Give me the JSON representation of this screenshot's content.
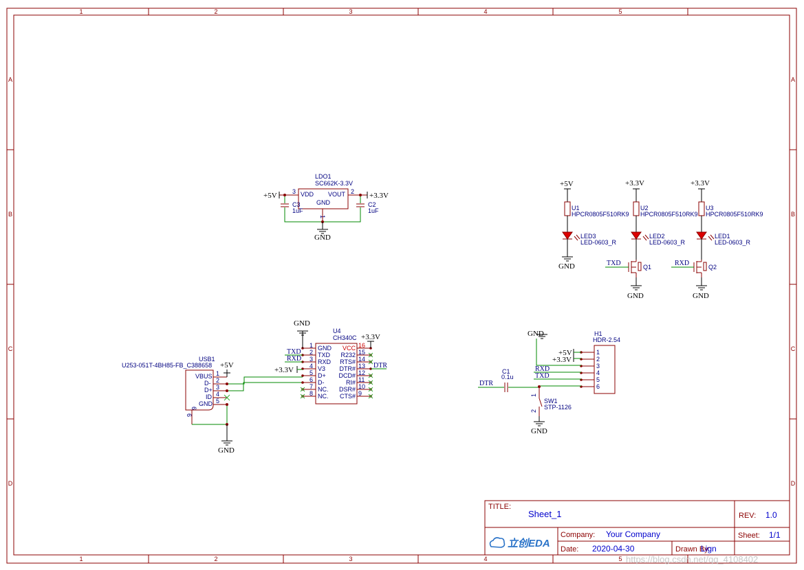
{
  "frame": {
    "columns": [
      "1",
      "2",
      "3",
      "4",
      "5"
    ],
    "rows": [
      "A",
      "B",
      "C",
      "D"
    ]
  },
  "title_block": {
    "title_label": "TITLE:",
    "title": "Sheet_1",
    "rev_label": "REV:",
    "rev": "1.0",
    "company_label": "Company:",
    "company": "Your Company",
    "sheet_label": "Sheet:",
    "sheet": "1/1",
    "date_label": "Date:",
    "date": "2020-04-30",
    "drawn_by_label": "Drawn By:",
    "drawn_by": "Lign",
    "logo": "立创EDA"
  },
  "watermark": "https://blog.csdn.net/qq_4108402",
  "ldo": {
    "ref": "LDO1",
    "part": "SC662K-3.3V",
    "pins": {
      "vdd": "VDD",
      "vout": "VOUT",
      "gnd": "GND",
      "n3": "3",
      "n2": "2",
      "n1": "1"
    },
    "in_net": "+5V",
    "out_net": "+3.3V",
    "gnd_net": "GND",
    "c_left": {
      "ref": "C3",
      "value": "1uF"
    },
    "c_right": {
      "ref": "C2",
      "value": "1uF"
    }
  },
  "leds": [
    {
      "rail": "+5V",
      "res_ref": "U1",
      "res_part": "HPCR0805F510RK9",
      "led_ref": "LED3",
      "led_part": "LED-0603_R",
      "gnd": "GND"
    },
    {
      "rail": "+3.3V",
      "res_ref": "U2",
      "res_part": "HPCR0805F510RK9",
      "led_ref": "LED2",
      "led_part": "LED-0603_R",
      "gnd": "GND",
      "q_ref": "Q1",
      "q_net": "TXD"
    },
    {
      "rail": "+3.3V",
      "res_ref": "U3",
      "res_part": "HPCR0805F510RK9",
      "led_ref": "LED1",
      "led_part": "LED-0603_R",
      "gnd": "GND",
      "q_ref": "Q2",
      "q_net": "RXD"
    }
  ],
  "usb": {
    "ref": "USB1",
    "part": "U253-051T-4BH85-FB_C388658",
    "pins": [
      {
        "num": "1",
        "name": "VBUS"
      },
      {
        "num": "2",
        "name": "D-"
      },
      {
        "num": "3",
        "name": "D+"
      },
      {
        "num": "4",
        "name": "ID"
      },
      {
        "num": "5",
        "name": "GND"
      }
    ],
    "shield_pin": "6",
    "shield_pin2": "6",
    "vbus_net": "+5V",
    "gnd_net": "GND"
  },
  "ch340": {
    "ref": "U4",
    "part": "CH340C",
    "left_pins": [
      {
        "num": "1",
        "name": "GND",
        "net": ""
      },
      {
        "num": "2",
        "name": "TXD",
        "net": "TXD"
      },
      {
        "num": "3",
        "name": "RXD",
        "net": "RXD"
      },
      {
        "num": "4",
        "name": "V3",
        "net": "+3.3V"
      },
      {
        "num": "5",
        "name": "D+",
        "net": ""
      },
      {
        "num": "6",
        "name": "D-",
        "net": ""
      },
      {
        "num": "7",
        "name": "NC.",
        "net": ""
      },
      {
        "num": "8",
        "name": "NC.",
        "net": ""
      }
    ],
    "right_pins": [
      {
        "num": "16",
        "name": "VCC"
      },
      {
        "num": "15",
        "name": "R232"
      },
      {
        "num": "14",
        "name": "RTS#"
      },
      {
        "num": "13",
        "name": "DTR#"
      },
      {
        "num": "12",
        "name": "DCD#"
      },
      {
        "num": "11",
        "name": "RI#"
      },
      {
        "num": "10",
        "name": "DSR#"
      },
      {
        "num": "9",
        "name": "CTS#"
      }
    ],
    "gnd_net": "GND",
    "vcc_net": "+3.3V",
    "dtr_net": "DTR"
  },
  "header": {
    "ref": "H1",
    "part": "HDR-2.54",
    "pins": [
      "1",
      "2",
      "3",
      "4",
      "5",
      "6"
    ],
    "nets": [
      "",
      "+5V",
      "+3.3V",
      "RXD",
      "TXD",
      ""
    ],
    "gnd_net": "GND",
    "cap": {
      "ref": "C1",
      "value": "0.1u"
    },
    "dtr_net": "DTR",
    "sw": {
      "ref": "SW1",
      "part": "STP-1126",
      "p1": "1",
      "p2": "2"
    },
    "sw_gnd": "GND"
  }
}
